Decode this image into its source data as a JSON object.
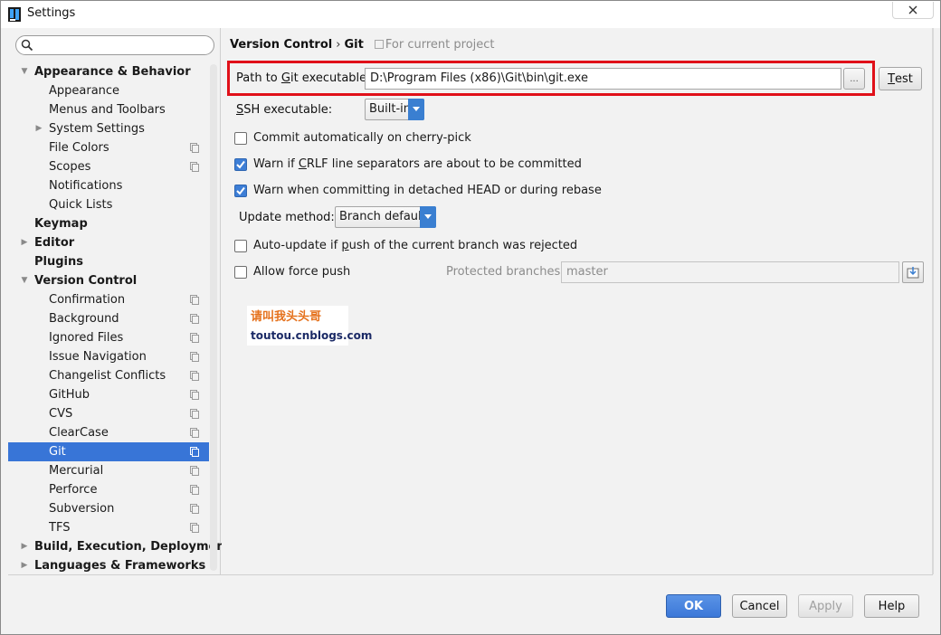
{
  "window": {
    "title": "Settings"
  },
  "search": {
    "value": "",
    "placeholder": ""
  },
  "tree": {
    "items": [
      {
        "label": "Appearance & Behavior",
        "level": 0,
        "bold": true,
        "expanded": true
      },
      {
        "label": "Appearance",
        "level": 1
      },
      {
        "label": "Menus and Toolbars",
        "level": 1
      },
      {
        "label": "System Settings",
        "level": 1,
        "collapsed": true
      },
      {
        "label": "File Colors",
        "level": 1,
        "project": true
      },
      {
        "label": "Scopes",
        "level": 1,
        "project": true
      },
      {
        "label": "Notifications",
        "level": 1
      },
      {
        "label": "Quick Lists",
        "level": 1
      },
      {
        "label": "Keymap",
        "level": 0,
        "bold": true
      },
      {
        "label": "Editor",
        "level": 0,
        "bold": true,
        "collapsed": true
      },
      {
        "label": "Plugins",
        "level": 0,
        "bold": true
      },
      {
        "label": "Version Control",
        "level": 0,
        "bold": true,
        "expanded": true
      },
      {
        "label": "Confirmation",
        "level": 1,
        "project": true
      },
      {
        "label": "Background",
        "level": 1,
        "project": true
      },
      {
        "label": "Ignored Files",
        "level": 1,
        "project": true
      },
      {
        "label": "Issue Navigation",
        "level": 1,
        "project": true
      },
      {
        "label": "Changelist Conflicts",
        "level": 1,
        "project": true
      },
      {
        "label": "GitHub",
        "level": 1,
        "project": true
      },
      {
        "label": "CVS",
        "level": 1,
        "project": true
      },
      {
        "label": "ClearCase",
        "level": 1,
        "project": true
      },
      {
        "label": "Git",
        "level": 1,
        "project": true,
        "selected": true
      },
      {
        "label": "Mercurial",
        "level": 1,
        "project": true
      },
      {
        "label": "Perforce",
        "level": 1,
        "project": true
      },
      {
        "label": "Subversion",
        "level": 1,
        "project": true
      },
      {
        "label": "TFS",
        "level": 1,
        "project": true
      },
      {
        "label": "Build, Execution, Deployment",
        "level": 0,
        "bold": true,
        "collapsed": true
      },
      {
        "label": "Languages & Frameworks",
        "level": 0,
        "bold": true,
        "collapsed": true
      }
    ]
  },
  "breadcrumb": {
    "parent": "Version Control",
    "separator": "›",
    "current": "Git",
    "hint": "For current project"
  },
  "git": {
    "path_label_pre": "Path to ",
    "path_label_u": "G",
    "path_label_post": "it executable:",
    "path_value": "D:\\Program Files (x86)\\Git\\bin\\git.exe",
    "browse_label": "...",
    "test_label_u": "T",
    "test_label_post": "est",
    "ssh_label_u": "S",
    "ssh_label_post": "SH executable:",
    "ssh_value": "Built-in",
    "commit_cherry_pick_label": "Commit automatically on cherry-pick",
    "commit_cherry_pick_checked": false,
    "crlf_label_pre": "Warn if ",
    "crlf_label_u": "C",
    "crlf_label_post": "RLF line separators are about to be committed",
    "crlf_checked": true,
    "detached_label": "Warn when committing in detached HEAD or during rebase",
    "detached_checked": true,
    "update_method_label": "Update method:",
    "update_method_value": "Branch default",
    "auto_update_label_pre": "Auto-update if ",
    "auto_update_label_u": "p",
    "auto_update_label_post": "ush of the current branch was rejected",
    "auto_update_checked": false,
    "force_push_label": "Allow force push",
    "force_push_checked": false,
    "protected_branches_label": "Protected branches:",
    "protected_branches_value": "master"
  },
  "watermark": {
    "chinese": "请叫我头头哥",
    "url": "toutou.cnblogs.com"
  },
  "footer": {
    "ok": "OK",
    "cancel": "Cancel",
    "apply": "Apply",
    "help": "Help"
  },
  "colors": {
    "selection": "#3875d7",
    "highlight_border": "#e01019",
    "ok_button": "#3c78d8"
  }
}
